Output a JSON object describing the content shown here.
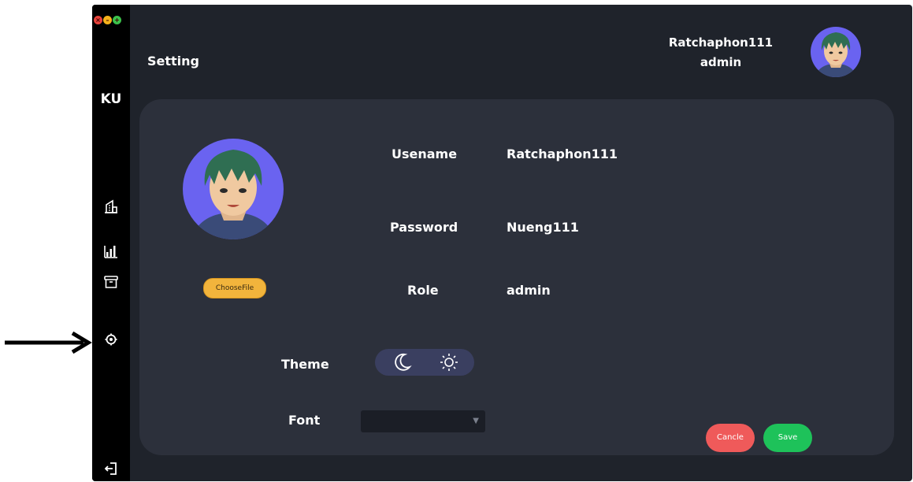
{
  "window": {
    "traffic": [
      "close",
      "minimize",
      "maximize"
    ]
  },
  "sidebar": {
    "brand": "KU",
    "items": [
      {
        "name": "building-icon"
      },
      {
        "name": "bar-chart-icon"
      },
      {
        "name": "archive-box-icon"
      },
      {
        "name": "gear-icon"
      }
    ],
    "logout_icon": "logout-icon"
  },
  "header": {
    "title": "Setting",
    "user_name": "Ratchaphon111",
    "user_role": "admin"
  },
  "profile": {
    "choose_file_label": "ChooseFile",
    "username_label": "Usename",
    "username_value": "Ratchaphon111",
    "password_label": "Password",
    "password_value": "Nueng111",
    "role_label": "Role",
    "role_value": "admin"
  },
  "settings": {
    "theme_label": "Theme",
    "theme_options": [
      "moon-icon",
      "sun-icon"
    ],
    "font_label": "Font",
    "font_value": ""
  },
  "actions": {
    "cancel_label": "Cancle",
    "save_label": "Save"
  },
  "colors": {
    "window_bg": "#1f232b",
    "card_bg": "#2c303b",
    "sidebar_bg": "#000000",
    "choose_file": "#f2b43c",
    "cancel": "#ef5a5a",
    "save": "#1ec25a",
    "theme_toggle_bg": "#3a3f60"
  }
}
